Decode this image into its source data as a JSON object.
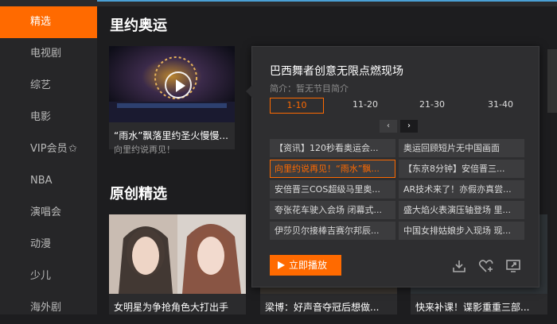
{
  "sidebar": {
    "items": [
      {
        "label": "精选",
        "active": true
      },
      {
        "label": "电视剧"
      },
      {
        "label": "综艺"
      },
      {
        "label": "电影"
      },
      {
        "label": "VIP会员",
        "icon": "vip-crown-icon"
      },
      {
        "label": "NBA"
      },
      {
        "label": "演唱会"
      },
      {
        "label": "动漫"
      },
      {
        "label": "少儿"
      },
      {
        "label": "海外剧"
      }
    ]
  },
  "section1": {
    "title": "里约奥运",
    "card": {
      "caption": "“雨水”飘落里约圣火慢慢...",
      "subcaption": "向里约说再见！"
    }
  },
  "section2": {
    "title": "原创精选",
    "cards": [
      {
        "caption": "女明星为争抢角色大打出手"
      },
      {
        "caption": "梁博：好声音夺冠后想做..."
      },
      {
        "caption": "快来补课！谍影重重三部..."
      }
    ]
  },
  "popup": {
    "title": "巴西舞者创意无限点燃现场",
    "intro": "简介：暂无节目简介",
    "tabs": [
      "1-10",
      "11-20",
      "21-30",
      "31-40"
    ],
    "pager": {
      "prev": "‹",
      "next": "›"
    },
    "episodes": [
      "【资讯】120秒看奥运会...",
      "奥运回顾短片无中国画面",
      "向里约说再见！“雨水”飘...",
      "【东京8分钟】安倍晋三...",
      "安倍晋三COS超级马里奥...",
      "AR技术来了！亦假亦真尝...",
      "夸张花车驶入会场 闭幕式...",
      "盛大焰火表演压轴登场 里...",
      "伊莎贝尔接棒吉赛尔邦辰...",
      "中国女排姑娘步入现场 现..."
    ],
    "active_episode": 2,
    "play_button": "立即播放",
    "actions": [
      "download-icon",
      "favorite-add-icon",
      "share-screen-icon"
    ]
  },
  "colors": {
    "accent": "#ff6a00",
    "background": "#1d1d1f",
    "sidebar": "#262628",
    "topline": "#4aa0d6"
  }
}
